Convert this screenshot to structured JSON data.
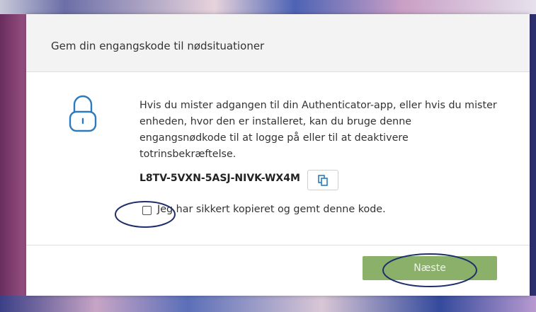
{
  "dialog": {
    "title": "Gem din engangskode til nødsituationer",
    "body_text": "Hvis du mister adgangen til din Authenticator-app, eller hvis du mister enheden, hvor den er installeret, kan du bruge denne engangsnødkode til at logge på eller til at deaktivere totrinsbekræftelse.",
    "recovery_code": "L8TV-5VXN-5ASJ-NIVK-WX4M",
    "checkbox_label": "Jeg har sikkert kopieret og gemt denne kode.",
    "checkbox_checked": false,
    "next_label": "Næste",
    "icons": [
      "lock-icon",
      "copy-icon"
    ],
    "colors": {
      "next_button": "#8bb06a",
      "annotation": "#1f2f6b"
    }
  }
}
